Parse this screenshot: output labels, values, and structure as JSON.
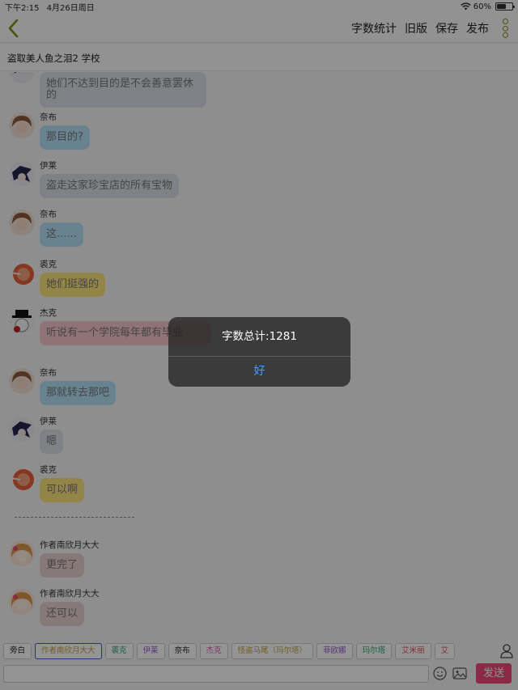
{
  "status_bar": {
    "time": "下午2:15",
    "date": "4月26日周日",
    "battery": "60%",
    "battery_level": 0.6
  },
  "nav": {
    "back_icon": "chevron-left-icon",
    "word_count": "字数统计",
    "old_version": "旧版",
    "save": "保存",
    "publish": "发布",
    "more_icon": "more-vertical-icon"
  },
  "title": "盗取美人鱼之泪2 学校",
  "messages": [
    {
      "sender": "",
      "text": "她们不达到目的是不会善意罢休的",
      "color": "gray"
    },
    {
      "sender": "奈布",
      "text": "那目的?",
      "color": "sky"
    },
    {
      "sender": "伊莱",
      "text": "盗走这家珍宝店的所有宝物",
      "color": "gray"
    },
    {
      "sender": "奈布",
      "text": "这......",
      "color": "sky"
    },
    {
      "sender": "裘克",
      "text": "她们挺强的",
      "color": "yellow"
    },
    {
      "sender": "杰克",
      "text": "听说有一个学院每年都有毕业",
      "color": "pink"
    },
    {
      "sender": "奈布",
      "text": "那就转去那吧",
      "color": "sky"
    },
    {
      "sender": "伊莱",
      "text": "嗯",
      "color": "gray"
    },
    {
      "sender": "裘克",
      "text": "可以啊",
      "color": "yellow"
    },
    {
      "sender": "作者南欣月大大",
      "text": "更完了",
      "color": "rose"
    },
    {
      "sender": "作者南欣月大大",
      "text": "还可以",
      "color": "rose"
    }
  ],
  "characters": [
    {
      "label": "旁白",
      "color": "#222222"
    },
    {
      "label": "作者南欣月大大",
      "color": "#c8a040"
    },
    {
      "label": "裘克",
      "color": "#2aa870"
    },
    {
      "label": "伊莱",
      "color": "#9a5ad0"
    },
    {
      "label": "奈布",
      "color": "#222222"
    },
    {
      "label": "杰克",
      "color": "#e050b0"
    },
    {
      "label": "怪盗马尾（玛尔塔）",
      "color": "#c8a040"
    },
    {
      "label": "菲欧娜",
      "color": "#9a5ad0"
    },
    {
      "label": "玛尔塔",
      "color": "#2aa870"
    },
    {
      "label": "艾米丽",
      "color": "#e05050"
    },
    {
      "label": "艾",
      "color": "#e05050"
    }
  ],
  "input": {
    "value": "",
    "placeholder": ""
  },
  "send_label": "发送",
  "dialog": {
    "message": "字数总计:1281",
    "ok": "好"
  },
  "colors": {
    "accent": "#8a8a1a",
    "send": "#f0477a",
    "dialog_button": "#4a9cf6"
  }
}
